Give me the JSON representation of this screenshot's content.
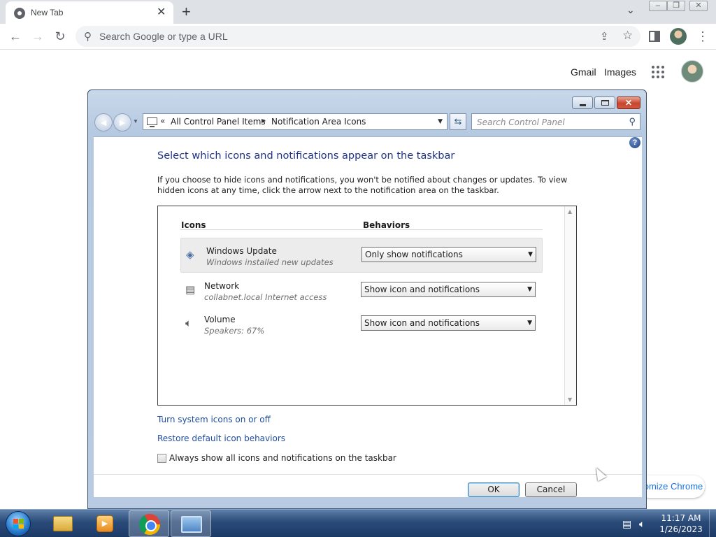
{
  "browser": {
    "tab_title": "New Tab",
    "omnibox_placeholder": "Search Google or type a URL",
    "top_links": {
      "gmail": "Gmail",
      "images": "Images"
    },
    "customize_label": "Customize Chrome"
  },
  "dialog": {
    "address": {
      "chevron": "«",
      "crumbs": [
        "All Control Panel Items",
        "Notification Area Icons"
      ]
    },
    "search_placeholder": "Search Control Panel",
    "heading": "Select which icons and notifications appear on the taskbar",
    "description": "If you choose to hide icons and notifications, you won't be notified about changes or updates. To view hidden icons at any time, click the arrow next to the notification area on the taskbar.",
    "columns": {
      "icons": "Icons",
      "behaviors": "Behaviors"
    },
    "rows": [
      {
        "name": "Windows Update",
        "sub": "Windows installed new updates",
        "behavior": "Only show notifications",
        "icon": "windows-update-icon"
      },
      {
        "name": "Network",
        "sub": "collabnet.local Internet access",
        "behavior": "Show icon and notifications",
        "icon": "network-icon"
      },
      {
        "name": "Volume",
        "sub": "Speakers: 67%",
        "behavior": "Show icon and notifications",
        "icon": "speaker-icon"
      }
    ],
    "links": {
      "system_icons": "Turn system icons on or off",
      "restore": "Restore default icon behaviors"
    },
    "checkbox_label": "Always show all icons and notifications on the taskbar",
    "checkbox_checked": false,
    "ok": "OK",
    "cancel": "Cancel"
  },
  "taskbar": {
    "time": "11:17 AM",
    "date": "1/26/2023"
  },
  "colors": {
    "heading_blue": "#1e3287",
    "link_blue": "#1e4d9e",
    "taskbar": "#2a4a78"
  }
}
